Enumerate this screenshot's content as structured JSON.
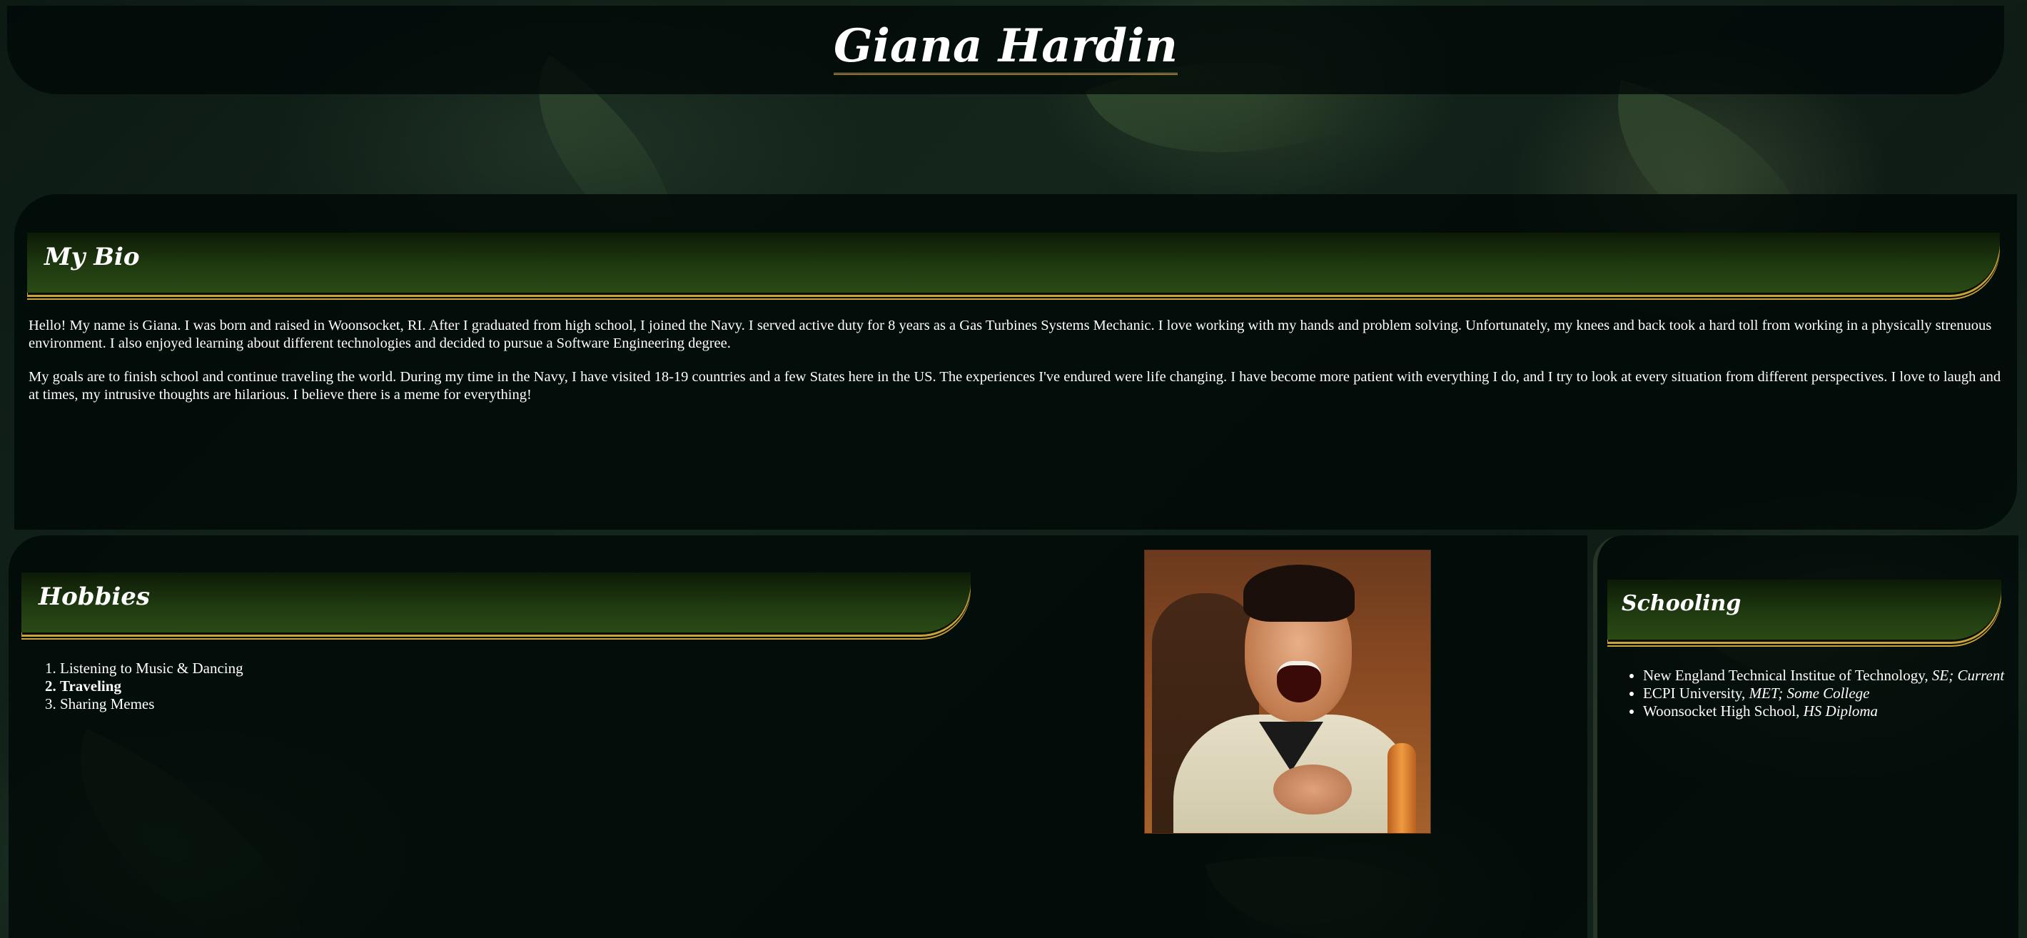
{
  "header": {
    "title": "Giana Hardin"
  },
  "bio": {
    "heading": "My Bio",
    "paragraphs": [
      "Hello! My name is Giana. I was born and raised in Woonsocket, RI. After I graduated from high school, I joined the Navy. I served active duty for 8 years as a Gas Turbines Systems Mechanic. I love working with my hands and problem solving. Unfortunately, my knees and back took a hard toll from working in a physically strenuous environment. I also enjoyed learning about different technologies and decided to pursue a Software Engineering degree.",
      "My goals are to finish school and continue traveling the world. During my time in the Navy, I have visited 18-19 countries and a few States here in the US. The experiences I've endured were life changing. I have become more patient with everything I do, and I try to look at every situation from different perspectives. I love to laugh and at times, my intrusive thoughts are hilarious. I believe there is a meme for everything!"
    ]
  },
  "hobbies": {
    "heading": "Hobbies",
    "items": [
      "Listening to Music & Dancing",
      "Traveling",
      "Sharing Memes"
    ]
  },
  "schooling": {
    "heading": "Schooling",
    "items": [
      {
        "school": "New England Technical Institue of Technology, ",
        "detail": "SE; Current"
      },
      {
        "school": "ECPI University, ",
        "detail": "MET; Some College"
      },
      {
        "school": "Woonsocket High School, ",
        "detail": "HS Diploma"
      }
    ]
  },
  "colors": {
    "accent_gold": "#c9a23a",
    "heading_green": "#1f3a10",
    "panel_bg": "#00080680"
  }
}
